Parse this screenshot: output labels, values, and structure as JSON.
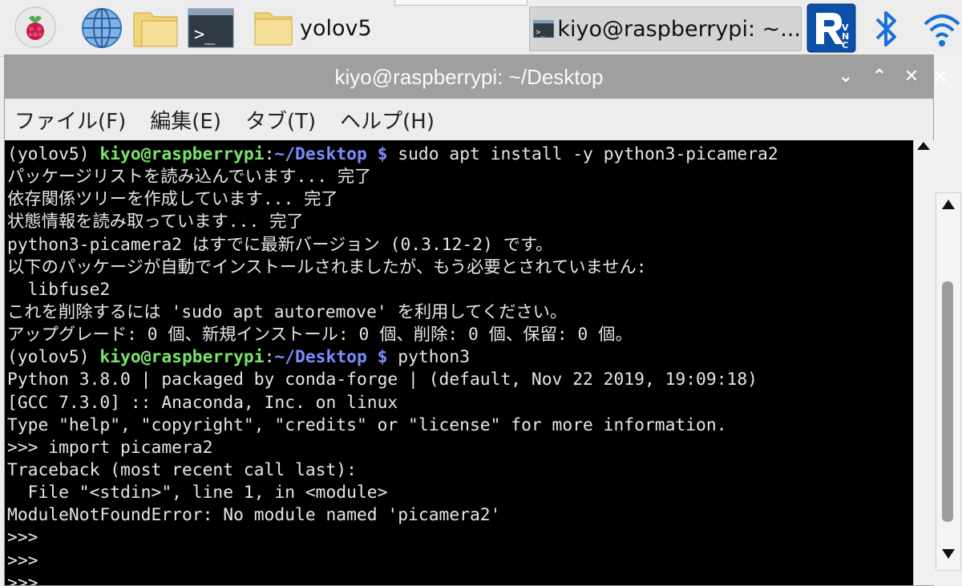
{
  "taskbar": {
    "windows": [
      {
        "label": "yolov5",
        "icon": "folder-icon"
      },
      {
        "label": "kiyo@raspberrypi: ~...",
        "icon": "terminal-icon"
      }
    ],
    "icons": [
      "raspberry-menu-icon",
      "web-browser-icon",
      "file-manager-icon",
      "terminal-launcher-icon",
      "vnc-icon",
      "bluetooth-icon",
      "wifi-icon"
    ],
    "colors": {
      "vnc": "#0b4fa8",
      "bluetooth": "#1a6fd8",
      "wifi": "#1a6fd8",
      "raspberry": "#c51a4a"
    }
  },
  "window": {
    "title": "kiyo@raspberrypi: ~/Desktop",
    "controls": [
      "⌄",
      "⌃",
      "✕"
    ],
    "menu": [
      "ファイル(F)",
      "編集(E)",
      "タブ(T)",
      "ヘルプ(H)"
    ]
  },
  "terminal": {
    "prompt": {
      "env": "(yolov5) ",
      "user": "kiyo@raspberrypi",
      "sep": ":",
      "path": "~/Desktop $",
      "sep2": " "
    },
    "command1": "sudo apt install -y python3-picamera2",
    "command2": "python3",
    "lines": [
      "パッケージリストを読み込んでいます... 完了",
      "依存関係ツリーを作成しています... 完了",
      "状態情報を読み取っています... 完了",
      "python3-picamera2 はすでに最新バージョン (0.3.12-2) です。",
      "以下のパッケージが自動でインストールされましたが、もう必要とされていません:",
      "  libfuse2",
      "これを削除するには 'sudo apt autoremove' を利用してください。",
      "アップグレード: 0 個、新規インストール: 0 個、削除: 0 個、保留: 0 個。"
    ],
    "lines2": [
      "Python 3.8.0 | packaged by conda-forge | (default, Nov 22 2019, 19:09:18)",
      "[GCC 7.3.0] :: Anaconda, Inc. on linux",
      "Type \"help\", \"copyright\", \"credits\" or \"license\" for more information.",
      ">>> import picamera2",
      "Traceback (most recent call last):",
      "  File \"<stdin>\", line 1, in <module>",
      "ModuleNotFoundError: No module named 'picamera2'",
      ">>>",
      ">>>",
      ">>>"
    ]
  },
  "background_window": {
    "close": "✕"
  }
}
